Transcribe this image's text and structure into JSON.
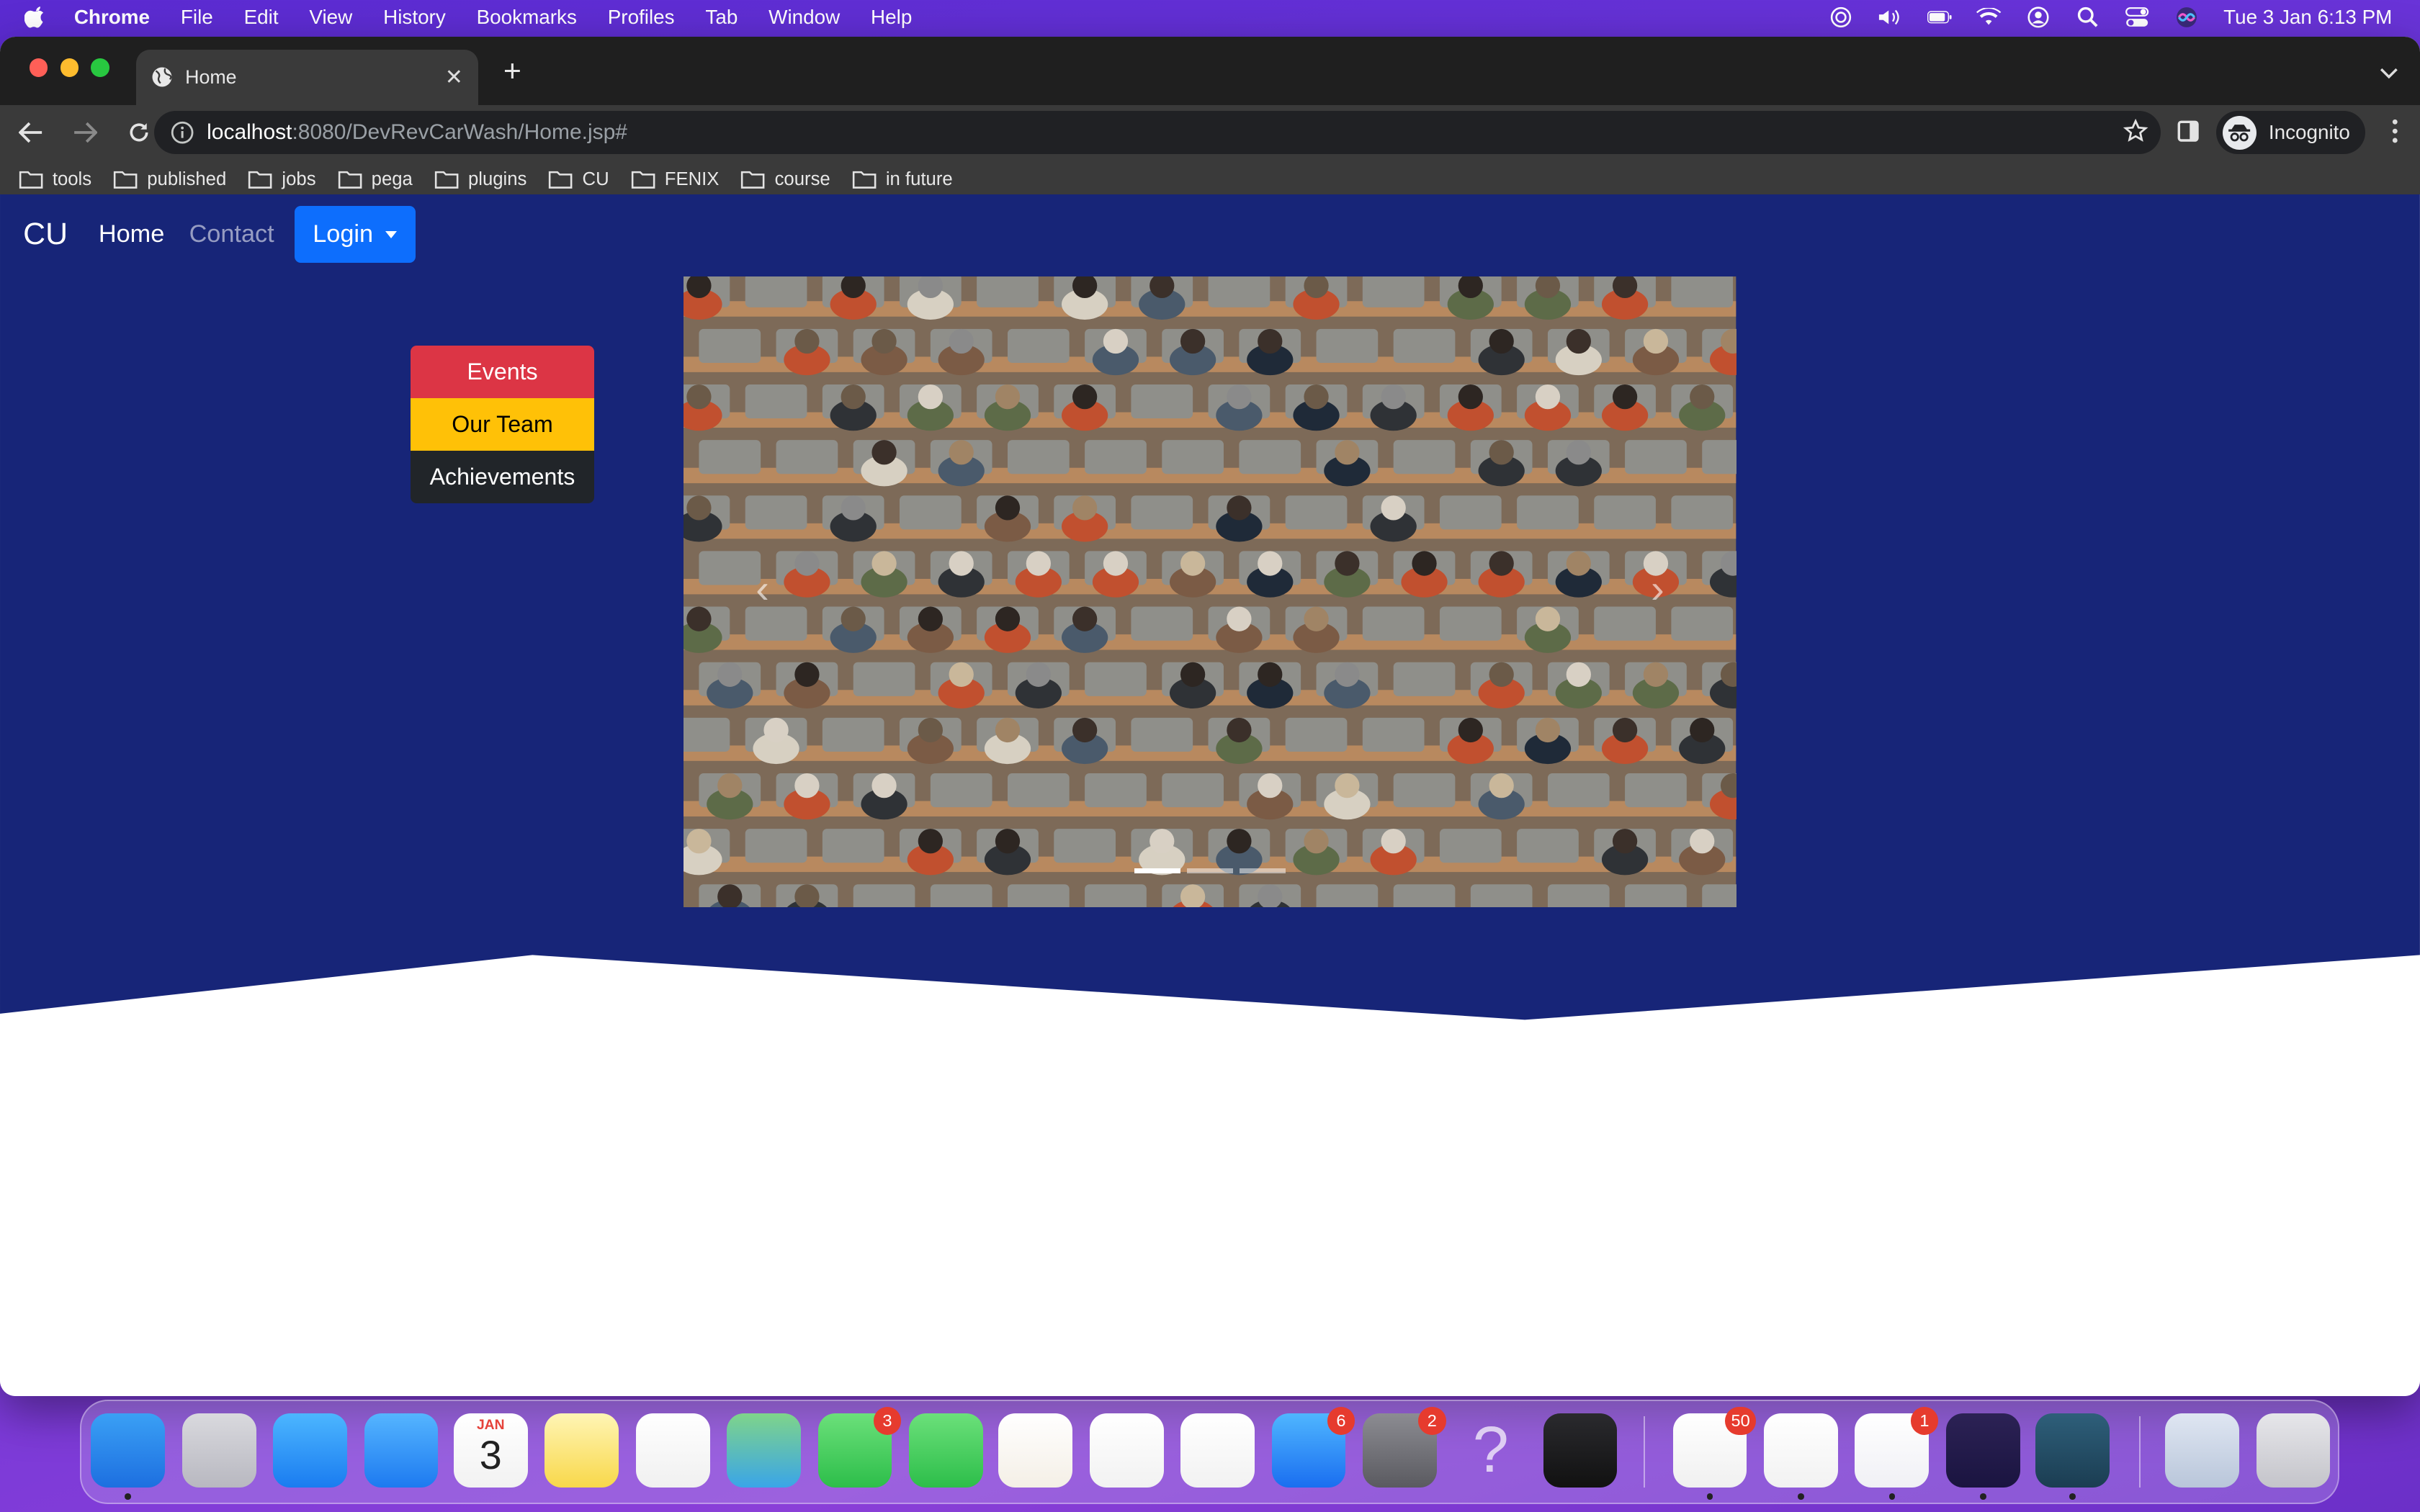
{
  "menubar": {
    "app": "Chrome",
    "items": [
      "File",
      "Edit",
      "View",
      "History",
      "Bookmarks",
      "Profiles",
      "Tab",
      "Window",
      "Help"
    ],
    "clock": "Tue 3 Jan  6:13 PM"
  },
  "browser": {
    "tab_title": "Home",
    "url_host": "localhost",
    "url_path": ":8080/DevRevCarWash/Home.jsp#",
    "profile_label": "Incognito",
    "bookmarks": [
      "tools",
      "published",
      "jobs",
      "pega",
      "plugins",
      "CU",
      "FENIX",
      "course",
      "in future"
    ]
  },
  "site": {
    "brand": "CU",
    "nav": {
      "home": "Home",
      "contact": "Contact",
      "login": "Login"
    },
    "side_buttons": {
      "events": "Events",
      "team": "Our Team",
      "achievements": "Achievements"
    },
    "carousel": {
      "slide_count": 3,
      "active_slide": 1
    },
    "colors": {
      "hero_bg": "#172578",
      "login": "#0d6efd",
      "events": "#dc3545",
      "team": "#ffc107",
      "achievements": "#212529"
    }
  },
  "dock": {
    "apps": [
      {
        "name": "finder-icon",
        "badge": ""
      },
      {
        "name": "launchpad-icon",
        "badge": ""
      },
      {
        "name": "safari-icon",
        "badge": ""
      },
      {
        "name": "mail-icon",
        "badge": ""
      },
      {
        "name": "calendar-icon",
        "badge": ""
      },
      {
        "name": "notes-icon",
        "badge": ""
      },
      {
        "name": "reminders-icon",
        "badge": ""
      },
      {
        "name": "maps-icon",
        "badge": ""
      },
      {
        "name": "messages-icon",
        "badge": "3"
      },
      {
        "name": "facetime-icon",
        "badge": ""
      },
      {
        "name": "pages-icon",
        "badge": ""
      },
      {
        "name": "numbers-icon",
        "badge": ""
      },
      {
        "name": "keynote-icon",
        "badge": ""
      },
      {
        "name": "app-store-icon",
        "badge": "6"
      },
      {
        "name": "system-settings-icon",
        "badge": "2"
      },
      {
        "name": "help-icon",
        "badge": ""
      },
      {
        "name": "quicktime-icon",
        "badge": ""
      },
      {
        "name": "slack-icon",
        "badge": "50"
      },
      {
        "name": "chrome-icon",
        "badge": ""
      },
      {
        "name": "teams-icon",
        "badge": "1"
      },
      {
        "name": "eclipse-icon",
        "badge": ""
      },
      {
        "name": "mysql-workbench-icon",
        "badge": ""
      },
      {
        "name": "documents-folder-icon",
        "badge": ""
      },
      {
        "name": "trash-icon",
        "badge": ""
      }
    ],
    "calendar_month": "JAN",
    "calendar_day": "3"
  }
}
